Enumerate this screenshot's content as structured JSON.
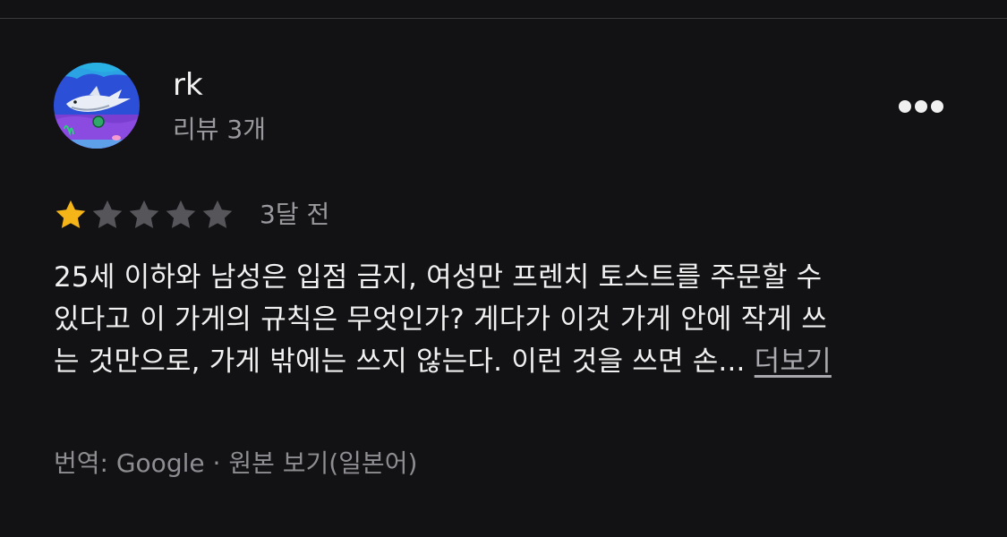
{
  "reviewer": {
    "name": "rk",
    "review_count": "리뷰 3개",
    "avatar_icon": "shark-avatar-icon"
  },
  "menu": {
    "icon": "more-options-icon"
  },
  "rating": {
    "value": 1,
    "max": 5,
    "filled_color": "#f5b417",
    "empty_color": "#55555a",
    "date": "3달 전"
  },
  "review": {
    "lines": [
      "25세 이하와 남성은 입점 금지, 여성만 프렌치 토스트를 주문할 수",
      "있다고 이 가게의 규칙은 무엇인가? 게다가 이것 가게 안에 작게 쓰",
      "는 것만으로, 가게 밖에는 쓰지 않는다. 이런 것을 쓰면 손..."
    ],
    "more_label": "더보기"
  },
  "translation": {
    "prefix": "번역: Google",
    "separator": "·",
    "original_link": "원본 보기(일본어)"
  }
}
